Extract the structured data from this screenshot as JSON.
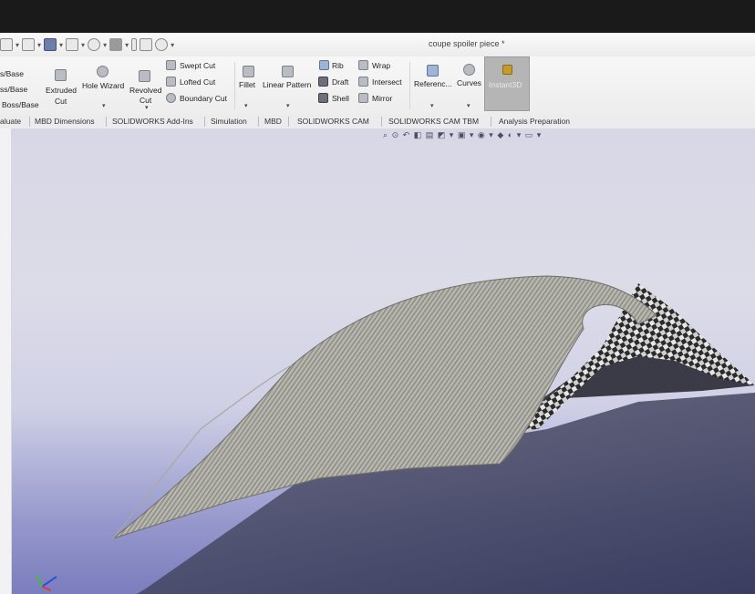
{
  "window": {
    "title": "coupe spoiler piece *"
  },
  "ribbon": {
    "boss_base_1": "s/Base",
    "boss_base_2": "ss/Base",
    "boss_base_3": "Boss/Base",
    "extruded_cut_1": "Extruded",
    "extruded_cut_2": "Cut",
    "hole_wizard": "Hole Wizard",
    "revolved_cut_1": "Revolved",
    "revolved_cut_2": "Cut",
    "swept_cut": "Swept Cut",
    "lofted_cut": "Lofted Cut",
    "boundary_cut": "Boundary Cut",
    "fillet": "Fillet",
    "linear_pattern": "Linear Pattern",
    "rib": "Rib",
    "draft": "Draft",
    "shell": "Shell",
    "wrap": "Wrap",
    "intersect": "Intersect",
    "mirror": "Mirror",
    "reference": "Referenc...",
    "curves": "Curves",
    "instant3d": "Instant3D"
  },
  "tabs": [
    "aluate",
    "MBD Dimensions",
    "SOLIDWORKS Add-Ins",
    "Simulation",
    "MBD",
    "SOLIDWORKS CAM",
    "SOLIDWORKS CAM TBM",
    "Analysis Preparation"
  ],
  "colors": {
    "ribbon_bg": "#efefef",
    "viewport_top": "#d7d7e6",
    "viewport_bottom": "#7b7dbd",
    "model_surface": "#b7b6ae",
    "carbon": "#3a3a3a"
  }
}
